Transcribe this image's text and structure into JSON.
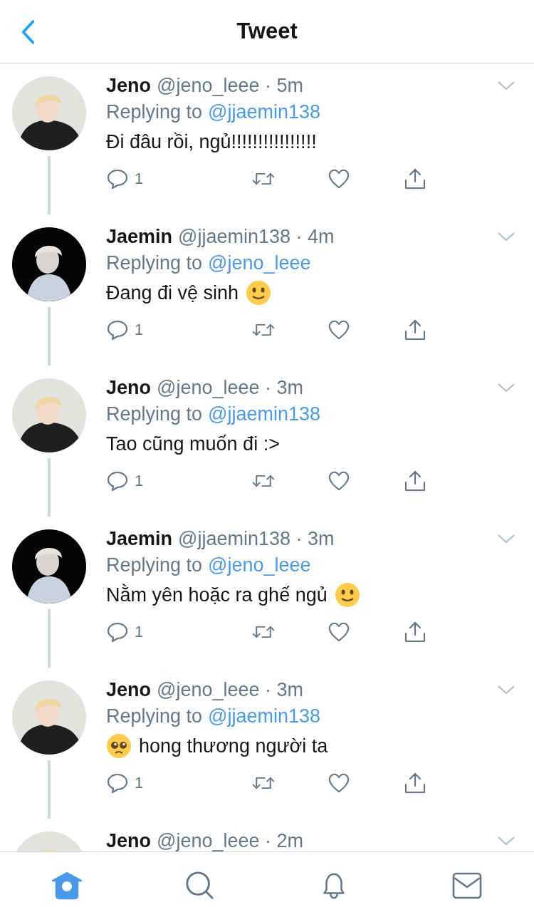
{
  "header": {
    "title": "Tweet"
  },
  "tweets": [
    {
      "name": "Jeno",
      "handle_time": "@jeno_leee · 5m",
      "replying_label": "Replying to",
      "replying_to": "@jjaemin138",
      "text": "Đi đâu rồi, ngủ!!!!!!!!!!!!!!!!",
      "dark_avatar": false,
      "replies": "1"
    },
    {
      "name": "Jaemin",
      "handle_time": "@jjaemin138 · 4m",
      "replying_label": "Replying to",
      "replying_to": "@jeno_leee",
      "text": "Đang đi vệ sinh",
      "smile_after": true,
      "dark_avatar": true,
      "replies": "1"
    },
    {
      "name": "Jeno",
      "handle_time": "@jeno_leee · 3m",
      "replying_label": "Replying to",
      "replying_to": "@jjaemin138",
      "text": "Tao cũng muốn đi :>",
      "dark_avatar": false,
      "replies": "1"
    },
    {
      "name": "Jaemin",
      "handle_time": "@jjaemin138 · 3m",
      "replying_label": "Replying to",
      "replying_to": "@jeno_leee",
      "text": "Nằm yên hoặc ra ghế ngủ",
      "smile_after": true,
      "dark_avatar": true,
      "replies": "1"
    },
    {
      "name": "Jeno",
      "handle_time": "@jeno_leee · 3m",
      "replying_label": "Replying to",
      "replying_to": "@jjaemin138",
      "text": "hong thương người ta",
      "pleading_before": true,
      "dark_avatar": false,
      "replies": "1"
    },
    {
      "name": "Jeno",
      "handle_time": "@jeno_leee · 2m",
      "dark_avatar": false
    }
  ],
  "tab_bar": [
    {
      "kind": "home",
      "selected": true
    },
    {
      "kind": "search",
      "selected": false
    },
    {
      "kind": "bell",
      "selected": false
    },
    {
      "kind": "mail",
      "selected": false
    }
  ]
}
